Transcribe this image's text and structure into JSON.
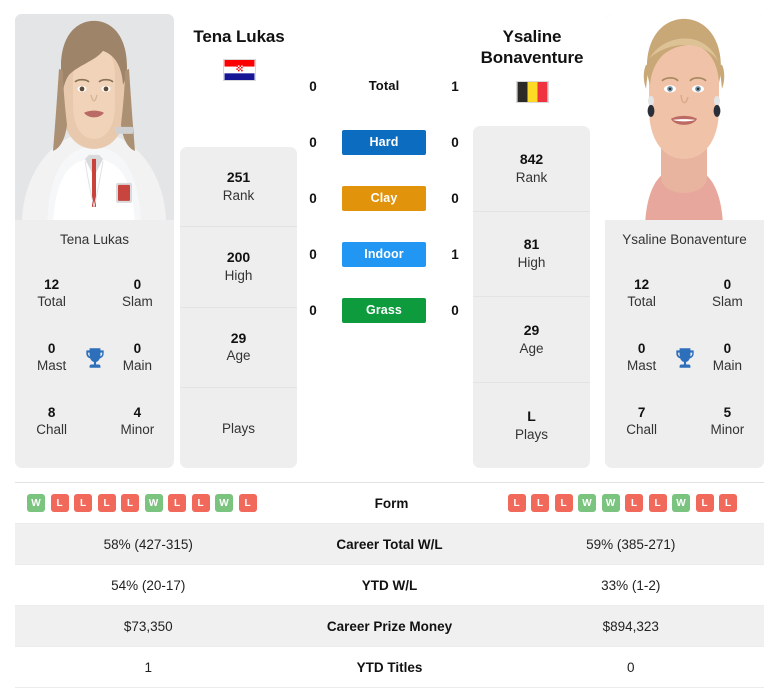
{
  "players": {
    "left": {
      "name": "Tena Lukas",
      "photo_caption": "Tena Lukas",
      "country": "croatia",
      "flag_name": "croatia-flag-icon",
      "titles": [
        {
          "value": "12",
          "label": "Total"
        },
        {
          "value": "0",
          "label": "Slam"
        },
        {
          "value": "0",
          "label": "Mast"
        },
        {
          "value": "0",
          "label": "Main"
        },
        {
          "value": "8",
          "label": "Chall"
        },
        {
          "value": "4",
          "label": "Minor"
        }
      ],
      "stats": [
        {
          "value": "251",
          "label": "Rank"
        },
        {
          "value": "200",
          "label": "High"
        },
        {
          "value": "29",
          "label": "Age"
        },
        {
          "value": "",
          "label": "Plays"
        }
      ],
      "form": [
        "W",
        "L",
        "L",
        "L",
        "L",
        "W",
        "L",
        "L",
        "W",
        "L"
      ],
      "career_total_wl": "58% (427-315)",
      "ytd_wl": "54% (20-17)",
      "career_prize_money": "$73,350",
      "ytd_titles": "1"
    },
    "right": {
      "name": "Ysaline Bonaventure",
      "photo_caption": "Ysaline Bonaventure",
      "country": "belgium",
      "flag_name": "belgium-flag-icon",
      "titles": [
        {
          "value": "12",
          "label": "Total"
        },
        {
          "value": "0",
          "label": "Slam"
        },
        {
          "value": "0",
          "label": "Mast"
        },
        {
          "value": "0",
          "label": "Main"
        },
        {
          "value": "7",
          "label": "Chall"
        },
        {
          "value": "5",
          "label": "Minor"
        }
      ],
      "stats": [
        {
          "value": "842",
          "label": "Rank"
        },
        {
          "value": "81",
          "label": "High"
        },
        {
          "value": "29",
          "label": "Age"
        },
        {
          "value": "L",
          "label": "Plays"
        }
      ],
      "form": [
        "L",
        "L",
        "L",
        "W",
        "W",
        "L",
        "L",
        "W",
        "L",
        "L"
      ],
      "career_total_wl": "59% (385-271)",
      "ytd_wl": "33% (1-2)",
      "career_prize_money": "$894,323",
      "ytd_titles": "0"
    }
  },
  "head_to_head": [
    {
      "label": "Total",
      "left": "0",
      "right": "1",
      "style": "plain",
      "color": ""
    },
    {
      "label": "Hard",
      "left": "0",
      "right": "0",
      "style": "badge",
      "color": "#0c6cc0"
    },
    {
      "label": "Clay",
      "left": "0",
      "right": "0",
      "style": "badge",
      "color": "#e0930b"
    },
    {
      "label": "Indoor",
      "left": "0",
      "right": "1",
      "style": "badge",
      "color": "#2196f3"
    },
    {
      "label": "Grass",
      "left": "0",
      "right": "0",
      "style": "badge",
      "color": "#0d9b3d"
    }
  ],
  "table_rows": [
    {
      "label": "Form",
      "type": "form"
    },
    {
      "label": "Career Total W/L",
      "type": "text",
      "key": "career_total_wl"
    },
    {
      "label": "YTD W/L",
      "type": "text",
      "key": "ytd_wl"
    },
    {
      "label": "Career Prize Money",
      "type": "text",
      "key": "career_prize_money"
    },
    {
      "label": "YTD Titles",
      "type": "text",
      "key": "ytd_titles"
    }
  ],
  "colors": {
    "win": "#7ac47f",
    "loss": "#f0695a",
    "trophy": "#2d6fba",
    "card_bg": "#eeeeee",
    "row_alt": "#f0f0f0"
  },
  "icons": {
    "trophy": "trophy-icon"
  }
}
